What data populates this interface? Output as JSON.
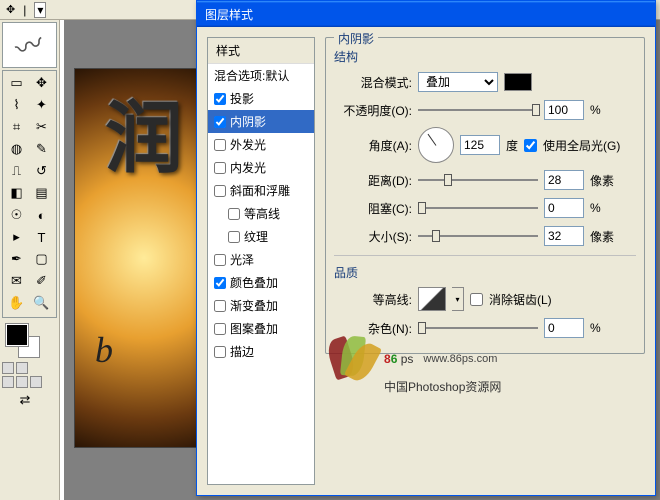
{
  "dialog": {
    "title": "图层样式",
    "styles_header": "样式",
    "blend_options": "混合选项:默认",
    "items": [
      {
        "label": "投影",
        "checked": true,
        "selected": false
      },
      {
        "label": "内阴影",
        "checked": true,
        "selected": true
      },
      {
        "label": "外发光",
        "checked": false,
        "selected": false
      },
      {
        "label": "内发光",
        "checked": false,
        "selected": false
      },
      {
        "label": "斜面和浮雕",
        "checked": false,
        "selected": false
      },
      {
        "label": "等高线",
        "checked": false,
        "selected": false,
        "indent": true
      },
      {
        "label": "纹理",
        "checked": false,
        "selected": false,
        "indent": true
      },
      {
        "label": "光泽",
        "checked": false,
        "selected": false
      },
      {
        "label": "颜色叠加",
        "checked": true,
        "selected": false
      },
      {
        "label": "渐变叠加",
        "checked": false,
        "selected": false
      },
      {
        "label": "图案叠加",
        "checked": false,
        "selected": false
      },
      {
        "label": "描边",
        "checked": false,
        "selected": false
      }
    ]
  },
  "panel": {
    "group_title": "内阴影",
    "structure": "结构",
    "blend_mode_label": "混合模式:",
    "blend_mode_value": "叠加",
    "opacity_label": "不透明度(O):",
    "opacity_value": "100",
    "opacity_unit": "%",
    "angle_label": "角度(A):",
    "angle_value": "125",
    "angle_unit": "度",
    "global_light": "使用全局光(G)",
    "distance_label": "距离(D):",
    "distance_value": "28",
    "distance_unit": "像素",
    "choke_label": "阻塞(C):",
    "choke_value": "0",
    "choke_unit": "%",
    "size_label": "大小(S):",
    "size_value": "32",
    "size_unit": "像素",
    "quality": "品质",
    "contour_label": "等高线:",
    "antialias": "消除锯齿(L)",
    "noise_label": "杂色(N):",
    "noise_value": "0",
    "noise_unit": "%"
  },
  "canvas": {
    "big_char": "润",
    "sub_char": "b"
  },
  "watermark": {
    "brand_8": "8",
    "brand_6": "6",
    "brand_ps": " ps",
    "url": "www.86ps.com",
    "subtitle": "中国Photoshop资源网"
  }
}
